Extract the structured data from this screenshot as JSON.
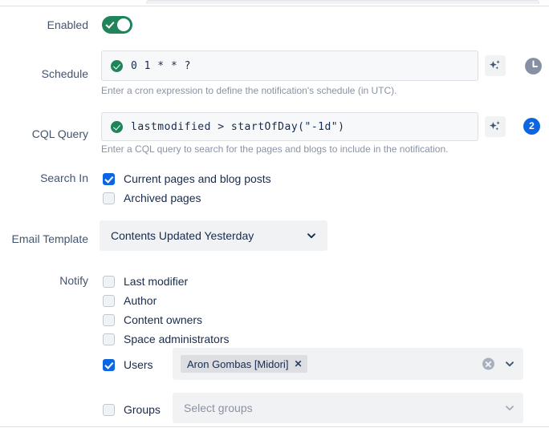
{
  "colors": {
    "toggle_on": "#1f845a",
    "checkbox_checked": "#0c66e4",
    "badge_blue": "#0c66e4",
    "valid_green": "#1f845a",
    "label_text": "#44546f",
    "helper_text": "#8993a4",
    "field_bg": "#f7f8f9",
    "select_bg": "#f1f2f4"
  },
  "form": {
    "enabled": {
      "label": "Enabled",
      "toggle_state": "on",
      "toggle_icon": "check-icon"
    },
    "schedule": {
      "label": "Schedule",
      "value": "0 1 * * ?",
      "valid_icon": "check-circle-icon",
      "helper": "Enter a cron expression to define the notification's schedule (in UTC).",
      "ai_icon": "sparkle-icon",
      "clock_icon": "clock-icon"
    },
    "cql_query": {
      "label": "CQL Query",
      "value": "lastmodified > startOfDay(\"-1d\")",
      "valid_icon": "check-circle-icon",
      "helper": "Enter a CQL query to search for the pages and blogs to include in the notification.",
      "ai_icon": "sparkle-icon",
      "result_count": "2"
    },
    "search_in": {
      "label": "Search In",
      "options": [
        {
          "label": "Current pages and blog posts",
          "checked": true
        },
        {
          "label": "Archived pages",
          "checked": false
        }
      ]
    },
    "email_template": {
      "label": "Email Template",
      "selected": "Contents Updated Yesterday",
      "chevron_icon": "chevron-down-icon"
    },
    "notify": {
      "label": "Notify",
      "options": [
        {
          "label": "Last modifier",
          "checked": false
        },
        {
          "label": "Author",
          "checked": false
        },
        {
          "label": "Content owners",
          "checked": false
        },
        {
          "label": "Space administrators",
          "checked": false
        }
      ],
      "users": {
        "label": "Users",
        "checked": true,
        "chips": [
          {
            "text": "Aron Gombas [Midori]",
            "remove_icon": "close-icon"
          }
        ],
        "clear_icon": "clear-circle-icon",
        "chevron_icon": "chevron-down-icon"
      },
      "groups": {
        "label": "Groups",
        "checked": false,
        "placeholder": "Select groups",
        "chevron_icon": "chevron-down-icon"
      }
    }
  }
}
